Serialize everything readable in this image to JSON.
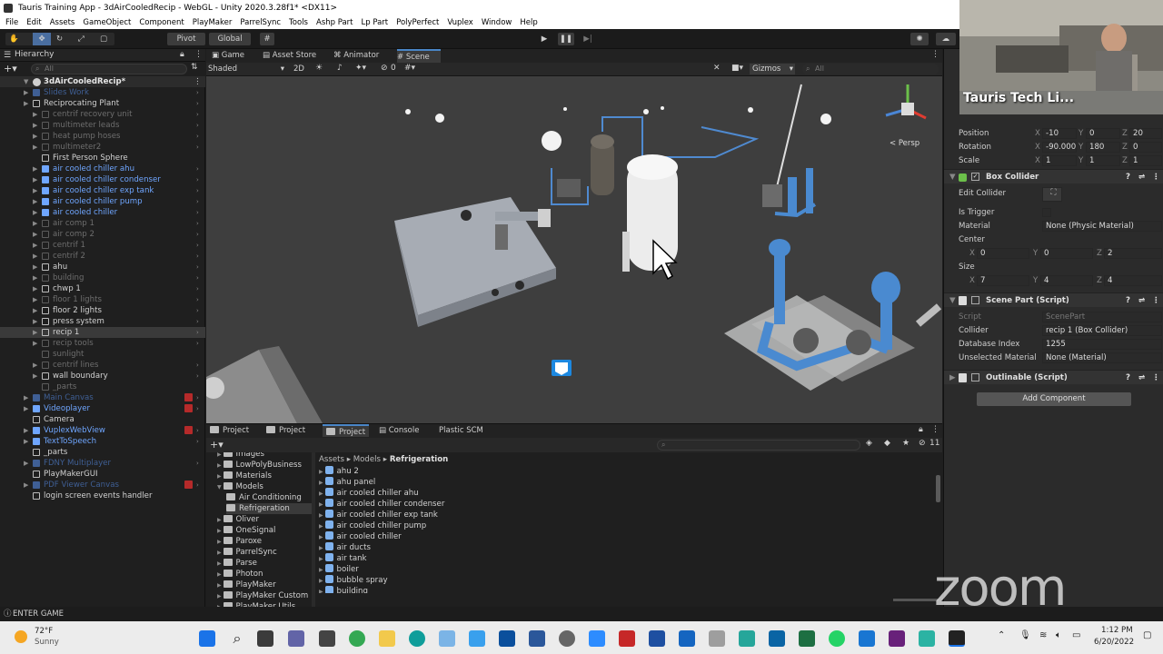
{
  "window": {
    "title": "Tauris Training App - 3dAirCooledRecip - WebGL - Unity 2020.3.28f1* <DX11>"
  },
  "menu": [
    "File",
    "Edit",
    "Assets",
    "GameObject",
    "Component",
    "PlayMaker",
    "ParrelSync",
    "Tools",
    "Ashp Part",
    "Lp Part",
    "PolyPerfect",
    "Vuplex",
    "Window",
    "Help"
  ],
  "toolbar": {
    "pivot": "Pivot",
    "global": "Global"
  },
  "hierarchy": {
    "title": "Hierarchy",
    "search_placeholder": "All",
    "scene_name": "3dAirCooledRecip*",
    "items": [
      {
        "label": "Slides Work",
        "style": "fblue",
        "indent": 1,
        "arrow": true
      },
      {
        "label": "Reciprocating Plant",
        "style": "white",
        "indent": 1,
        "arrow": true
      },
      {
        "label": "centrif recovery unit",
        "style": "grey",
        "indent": 2,
        "arrow": true
      },
      {
        "label": "multimeter leads",
        "style": "grey",
        "indent": 2,
        "arrow": true
      },
      {
        "label": "heat pump hoses",
        "style": "grey",
        "indent": 2,
        "arrow": true
      },
      {
        "label": "multimeter2",
        "style": "grey",
        "indent": 2,
        "arrow": true
      },
      {
        "label": "First Person Sphere",
        "style": "white",
        "indent": 2,
        "arrow": false
      },
      {
        "label": "air cooled chiller ahu",
        "style": "blue",
        "indent": 2,
        "arrow": true
      },
      {
        "label": "air cooled chiller condenser",
        "style": "blue",
        "indent": 2,
        "arrow": true
      },
      {
        "label": "air cooled chiller exp tank",
        "style": "blue",
        "indent": 2,
        "arrow": true
      },
      {
        "label": "air cooled chiller pump",
        "style": "blue",
        "indent": 2,
        "arrow": true
      },
      {
        "label": "air cooled chiller",
        "style": "blue",
        "indent": 2,
        "arrow": true
      },
      {
        "label": "air comp 1",
        "style": "grey",
        "indent": 2,
        "arrow": true
      },
      {
        "label": "air comp 2",
        "style": "grey",
        "indent": 2,
        "arrow": true
      },
      {
        "label": "centrif 1",
        "style": "grey",
        "indent": 2,
        "arrow": true
      },
      {
        "label": "centrif 2",
        "style": "grey",
        "indent": 2,
        "arrow": true
      },
      {
        "label": "ahu",
        "style": "white",
        "indent": 2,
        "arrow": true
      },
      {
        "label": "building",
        "style": "grey",
        "indent": 2,
        "arrow": true
      },
      {
        "label": "chwp 1",
        "style": "white",
        "indent": 2,
        "arrow": true
      },
      {
        "label": "floor 1 lights",
        "style": "grey",
        "indent": 2,
        "arrow": true
      },
      {
        "label": "floor 2 lights",
        "style": "white",
        "indent": 2,
        "arrow": true
      },
      {
        "label": "press system",
        "style": "white",
        "indent": 2,
        "arrow": true
      },
      {
        "label": "recip 1",
        "style": "white",
        "indent": 2,
        "arrow": true,
        "selected": true
      },
      {
        "label": "recip tools",
        "style": "grey",
        "indent": 2,
        "arrow": true
      },
      {
        "label": "sunlight",
        "style": "grey",
        "indent": 2,
        "arrow": false
      },
      {
        "label": "centrif lines",
        "style": "grey",
        "indent": 2,
        "arrow": true
      },
      {
        "label": "wall boundary",
        "style": "white",
        "indent": 2,
        "arrow": true
      },
      {
        "label": "_parts",
        "style": "grey",
        "indent": 2,
        "arrow": false
      },
      {
        "label": "Main Canvas",
        "style": "fblue",
        "indent": 1,
        "arrow": true,
        "badge": true
      },
      {
        "label": "Videoplayer",
        "style": "blue",
        "indent": 1,
        "arrow": true,
        "badge": true
      },
      {
        "label": "Camera",
        "style": "white",
        "indent": 1,
        "arrow": false
      },
      {
        "label": "VuplexWebView",
        "style": "blue",
        "indent": 1,
        "arrow": true,
        "badge": true
      },
      {
        "label": "TextToSpeech",
        "style": "blue",
        "indent": 1,
        "arrow": true
      },
      {
        "label": "_parts",
        "style": "white",
        "indent": 1,
        "arrow": false
      },
      {
        "label": "FDNY Multiplayer",
        "style": "fblue",
        "indent": 1,
        "arrow": true
      },
      {
        "label": "PlayMakerGUI",
        "style": "white",
        "indent": 1,
        "arrow": false
      },
      {
        "label": "PDF Viewer Canvas",
        "style": "fblue",
        "indent": 1,
        "arrow": true,
        "badge": true
      },
      {
        "label": "login screen events handler",
        "style": "white",
        "indent": 1,
        "arrow": false
      }
    ]
  },
  "scene": {
    "tabs": [
      "Game",
      "Asset Store",
      "Animator",
      "Scene"
    ],
    "shading": "Shaded",
    "mode_2d": "2D",
    "fx_count": "0",
    "gizmos": "Gizmos",
    "search_placeholder": "All",
    "persp": "< Persp"
  },
  "project": {
    "tabs": [
      "Project",
      "Project",
      "Project",
      "Console",
      "Plastic SCM"
    ],
    "count": "11",
    "breadcrumb": [
      "Assets",
      "Models",
      "Refrigeration"
    ],
    "folders": [
      {
        "label": "Images",
        "indent": 1
      },
      {
        "label": "LowPolyBusiness",
        "indent": 1
      },
      {
        "label": "Materials",
        "indent": 1
      },
      {
        "label": "Models",
        "indent": 1,
        "open": true
      },
      {
        "label": "Air Conditioning",
        "indent": 2
      },
      {
        "label": "Refrigeration",
        "indent": 2,
        "selected": true
      },
      {
        "label": "Oliver",
        "indent": 1
      },
      {
        "label": "OneSignal",
        "indent": 1
      },
      {
        "label": "Paroxe",
        "indent": 1
      },
      {
        "label": "ParrelSync",
        "indent": 1
      },
      {
        "label": "Parse",
        "indent": 1
      },
      {
        "label": "Photon",
        "indent": 1
      },
      {
        "label": "PlayMaker",
        "indent": 1
      },
      {
        "label": "PlayMaker Custom",
        "indent": 1
      },
      {
        "label": "PlayMaker Utils",
        "indent": 1
      }
    ],
    "assets": [
      "ahu 2",
      "ahu panel",
      "air cooled chiller ahu",
      "air cooled chiller condenser",
      "air cooled chiller exp tank",
      "air cooled chiller pump",
      "air cooled chiller",
      "air ducts",
      "air tank",
      "boiler",
      "bubble spray",
      "building"
    ]
  },
  "inspector": {
    "transform": {
      "position": {
        "label": "Position",
        "x": "-10",
        "y": "0",
        "z": "20"
      },
      "rotation": {
        "label": "Rotation",
        "x": "-90.000",
        "y": "180",
        "z": "0"
      },
      "scale": {
        "label": "Scale",
        "x": "1",
        "y": "1",
        "z": "1"
      }
    },
    "box_collider": {
      "title": "Box Collider",
      "edit_collider": "Edit Collider",
      "is_trigger": "Is Trigger",
      "material_label": "Material",
      "material_value": "None (Physic Material)",
      "center_label": "Center",
      "center": {
        "x": "0",
        "y": "0",
        "z": "2"
      },
      "size_label": "Size",
      "size": {
        "x": "7",
        "y": "4",
        "z": "4"
      }
    },
    "scene_part": {
      "title": "Scene Part (Script)",
      "script_label": "Script",
      "script_value": "ScenePart",
      "collider_label": "Collider",
      "collider_value": "recip 1 (Box Collider)",
      "db_label": "Database Index",
      "db_value": "1255",
      "unselected_label": "Unselected Material",
      "unselected_value": "None (Material)"
    },
    "outlinable": {
      "title": "Outlinable (Script)"
    },
    "add_component": "Add Component"
  },
  "webcam": {
    "name": "Tauris Tech Li..."
  },
  "zoom_watermark": "zoom",
  "status": {
    "text": "ENTER GAME"
  },
  "taskbar": {
    "weather_temp": "72°F",
    "weather_desc": "Sunny",
    "time": "1:12 PM",
    "date": "6/20/2022"
  },
  "colors": {
    "accent": "#2c5d87",
    "blue_prefab": "#6fa6ff",
    "pipe_blue": "#4a8ad0"
  }
}
